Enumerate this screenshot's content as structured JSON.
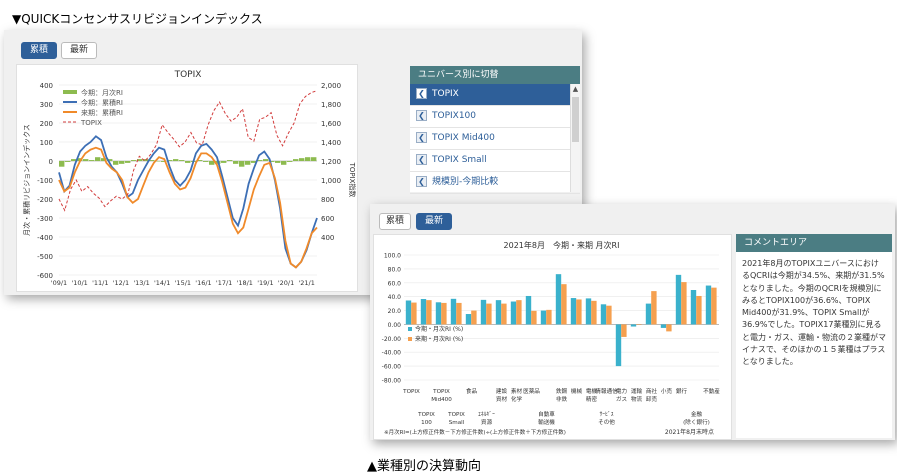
{
  "captions": {
    "top": "▼QUICKコンセンサスリビジョンインデックス",
    "bottom": "▲業種別の決算動向"
  },
  "back_panel": {
    "tabs": [
      {
        "label": "累積",
        "active": true
      },
      {
        "label": "最新",
        "active": false
      }
    ],
    "sidebar": {
      "title": "ユニバース別に切替",
      "items": [
        {
          "label": "TOPIX",
          "active": true
        },
        {
          "label": "TOPIX100",
          "active": false
        },
        {
          "label": "TOPIX Mid400",
          "active": false
        },
        {
          "label": "TOPIX Small",
          "active": false
        },
        {
          "label": "規模別-今期比較",
          "active": false
        }
      ]
    },
    "date_note": "2021年8月末"
  },
  "front_panel": {
    "tabs": [
      {
        "label": "累積",
        "active": false
      },
      {
        "label": "最新",
        "active": true
      }
    ],
    "comment": {
      "title": "コメントエリア",
      "text": "2021年8月のTOPIXユニバースにおけるQCRIは今期が34.5%、来期が31.5%となりました。今期のQCRIを規模別にみるとTOPIX100が36.6%、TOPIX Mid400が31.9%、TOPIX Smallが36.9%でした。TOPIX17業種別に見ると電力・ガス、運輸・物流の２業種がマイナスで、そのほかの１５業種はプラスとなりました。"
    }
  },
  "chart_data": [
    {
      "type": "line",
      "title": "TOPIX",
      "ylabel": "月次・累積リビジョンインデックス",
      "y2label": "TOPIX指数",
      "ylim": [
        -600,
        400
      ],
      "y2lim": [
        0,
        2000
      ],
      "yticks": [
        "400",
        "300",
        "200",
        "100",
        "0",
        "-100",
        "-200",
        "-300",
        "-400",
        "-500",
        "-600"
      ],
      "y2ticks": [
        "2,000",
        "1,800",
        "1,600",
        "1,400",
        "1,200",
        "1,000",
        "800",
        "600",
        "400"
      ],
      "categories": [
        "'09/1",
        "'10/1",
        "'11/1",
        "'12/1",
        "'13/1",
        "'14/1",
        "'15/1",
        "'16/1",
        "'17/1",
        "'18/1",
        "'19/1",
        "'20/1",
        "'21/1"
      ],
      "series": [
        {
          "name": "今期：月次RI",
          "type": "bar",
          "color": "#8dbb4f",
          "values": [
            -30,
            -5,
            10,
            15,
            10,
            5,
            20,
            15,
            10,
            -20,
            -15,
            -10,
            5,
            10,
            10,
            5,
            0,
            -5,
            5,
            10,
            5,
            -10,
            -5,
            5,
            -5,
            -20,
            -15,
            -10,
            5,
            -15,
            -30,
            -20,
            -10,
            5,
            10,
            -5,
            -10,
            -20,
            -5,
            10,
            15,
            20,
            20
          ]
        },
        {
          "name": "今期：累積RI",
          "color": "#3d6fb5",
          "values": [
            -60,
            -160,
            -130,
            -20,
            50,
            80,
            100,
            130,
            110,
            20,
            -30,
            -60,
            -120,
            -190,
            -170,
            -100,
            -50,
            0,
            40,
            70,
            60,
            -30,
            -100,
            -130,
            -100,
            -50,
            40,
            80,
            90,
            60,
            20,
            -80,
            -190,
            -300,
            -340,
            -250,
            -120,
            -40,
            30,
            50,
            10,
            -100,
            -250,
            -460,
            -540,
            -560,
            -530,
            -470,
            -380,
            -300
          ]
        },
        {
          "name": "来期：累積RI",
          "color": "#f08a2a",
          "values": [
            -100,
            -160,
            -140,
            -60,
            0,
            40,
            60,
            70,
            60,
            -10,
            -40,
            -60,
            -100,
            -190,
            -220,
            -200,
            -130,
            -60,
            -10,
            20,
            10,
            -60,
            -120,
            -150,
            -140,
            -90,
            -10,
            40,
            40,
            20,
            -20,
            -110,
            -220,
            -330,
            -380,
            -350,
            -250,
            -150,
            -80,
            -20,
            -10,
            -90,
            -220,
            -420,
            -540,
            -560,
            -530,
            -460,
            -380,
            -350
          ]
        },
        {
          "name": "TOPIX",
          "color": "#d23c3c",
          "axis": "right",
          "dashed": true,
          "values": [
            800,
            680,
            900,
            1000,
            880,
            930,
            860,
            810,
            720,
            780,
            830,
            800,
            850,
            1100,
            1250,
            1200,
            1270,
            1370,
            1580,
            1500,
            1430,
            1350,
            1400,
            1500,
            1390,
            1370,
            1580,
            1730,
            1820,
            1700,
            1620,
            1660,
            1750,
            1450,
            1410,
            1640,
            1660,
            1710,
            1470,
            1360,
            1490,
            1600,
            1800,
            1880,
            1920,
            1940
          ]
        }
      ],
      "legend_position": "top-left"
    },
    {
      "type": "bar",
      "title": "2021年8月　今期・来期 月次RI",
      "ylim": [
        -80,
        100
      ],
      "yticks": [
        "100.0",
        "80.0",
        "60.0",
        "40.0",
        "20.0",
        "0.00",
        "-20.00",
        "-40.00",
        "-60.00",
        "-80.00"
      ],
      "categories": [
        "TOPIX",
        "TOPIX100",
        "TOPIX Mid400",
        "TOPIX Small",
        "食品",
        "ｴﾈﾙｷﾞｰ資源",
        "建設資材",
        "素材化学",
        "医薬品",
        "自動車輸送機",
        "鉄鋼非鉄",
        "機械",
        "電機精密",
        "情報通信サービスその他",
        "電力ガス",
        "運輸物流",
        "商社卸売",
        "小売",
        "銀行",
        "金融(除く銀行)",
        "不動産"
      ],
      "category_labels": [
        {
          "top": "TOPIX",
          "bottom": ""
        },
        {
          "top": "",
          "bottom": "TOPIX 100"
        },
        {
          "top": "TOPIX Mid400",
          "bottom": ""
        },
        {
          "top": "",
          "bottom": "TOPIX Small"
        },
        {
          "top": "食品",
          "bottom": ""
        },
        {
          "top": "",
          "bottom": "ｴﾈﾙｷﾞｰ 資源"
        },
        {
          "top": "建設 資材",
          "bottom": ""
        },
        {
          "top": "素材 化学",
          "bottom": ""
        },
        {
          "top": "医薬品",
          "bottom": ""
        },
        {
          "top": "",
          "bottom": "自動車 輸送機"
        },
        {
          "top": "鉄鋼 非鉄",
          "bottom": ""
        },
        {
          "top": "機械",
          "bottom": ""
        },
        {
          "top": "電機 精密",
          "bottom": ""
        },
        {
          "top": "情報通信",
          "bottom": "ｻｰﾋﾞｽ その他"
        },
        {
          "top": "電力 ガス",
          "bottom": ""
        },
        {
          "top": "運輸 物流",
          "bottom": ""
        },
        {
          "top": "商社 卸売",
          "bottom": ""
        },
        {
          "top": "小売",
          "bottom": ""
        },
        {
          "top": "銀行",
          "bottom": ""
        },
        {
          "top": "",
          "bottom": "金融 (除く銀行)"
        },
        {
          "top": "不動産",
          "bottom": ""
        }
      ],
      "series": [
        {
          "name": "今期・月次RI (%)",
          "color": "#3ab1cc",
          "values": [
            34.5,
            36.6,
            31.9,
            36.9,
            15,
            35.4,
            35,
            33,
            41,
            20,
            72.4,
            38,
            37.5,
            29,
            -60,
            -3,
            30,
            -5,
            71.4,
            49.6,
            56
          ]
        },
        {
          "name": "来期・月次RI (%)",
          "color": "#f5a04f",
          "values": [
            31.5,
            35,
            31,
            31,
            20,
            30,
            30,
            35,
            19.6,
            21,
            58,
            36,
            34,
            27,
            -18,
            0,
            48,
            -10,
            61,
            41,
            53
          ]
        }
      ],
      "legend_position": "bottom-left",
      "footnote": "※月次RI=(上方修正件数－下方修正件数)÷(上方修正件数＋下方修正件数)",
      "date_note": "2021年8月末時点"
    }
  ]
}
